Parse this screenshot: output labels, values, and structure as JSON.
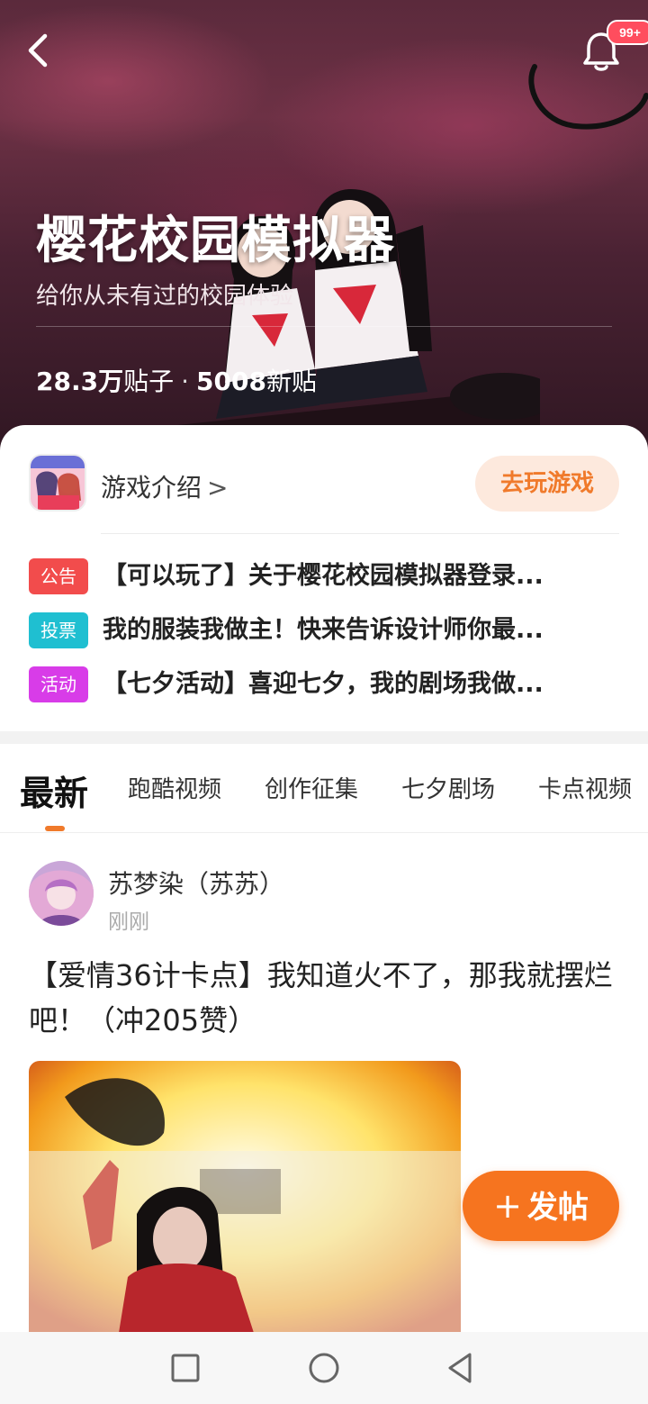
{
  "hero": {
    "title": "樱花校园模拟器",
    "subtitle": "给你从未有过的校园体验",
    "stats_posts": "28.3万",
    "stats_posts_label": "贴子",
    "stats_separator": "·",
    "stats_new": "5008",
    "stats_new_label": "新贴",
    "notification_badge": "99+"
  },
  "card": {
    "game_intro": "游戏介绍",
    "game_intro_chevron": ">",
    "play_button": "去玩游戏",
    "notices": [
      {
        "tag": "公告",
        "tag_color": "#f24c4c",
        "text": "【可以玩了】关于樱花校园模拟器登录..."
      },
      {
        "tag": "投票",
        "tag_color": "#1fbfd1",
        "text": "我的服装我做主！快来告诉设计师你最..."
      },
      {
        "tag": "活动",
        "tag_color": "#d83ce8",
        "text": "【七夕活动】喜迎七夕，我的剧场我做..."
      }
    ]
  },
  "tabs": [
    "最新",
    "跑酷视频",
    "创作征集",
    "七夕剧场",
    "卡点视频"
  ],
  "post": {
    "author": "苏梦染（苏苏）",
    "time": "刚刚",
    "title": "【爱情36计卡点】我知道火不了，那我就摆烂吧！（冲205赞）"
  },
  "fab": {
    "plus": "+",
    "label": "发帖"
  },
  "colors": {
    "accent": "#f6741f",
    "accent_soft": "#fde9dd",
    "badge": "#ff4d5e"
  },
  "icons": {
    "back": "back-arrow-icon",
    "bell": "bell-icon",
    "nav_recent": "square-icon",
    "nav_home": "circle-icon",
    "nav_back": "triangle-back-icon"
  }
}
